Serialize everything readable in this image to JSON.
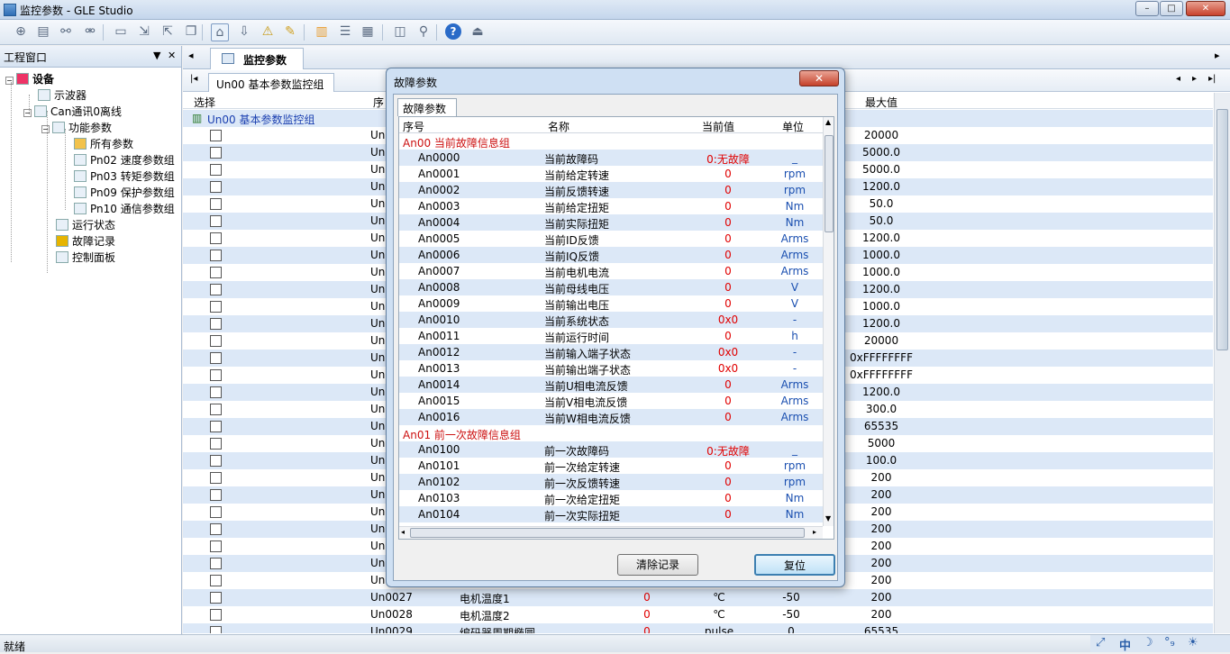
{
  "window": {
    "title": "监控参数 - GLE Studio",
    "min": "–",
    "max": "□",
    "close": "✕"
  },
  "toolbar": {
    "icons": [
      "new-icon",
      "open-icon",
      "connect-icon",
      "disconnect-icon",
      "window-icon",
      "import-icon",
      "export-icon",
      "copy-icon",
      "home-icon",
      "download-icon",
      "alarm-icon",
      "edit-icon",
      "chart-icon",
      "report-icon",
      "table-icon",
      "layout-icon",
      "zoom-icon",
      "help-icon",
      "exit-icon"
    ]
  },
  "left_panel": {
    "title": "工程窗口",
    "pin": "▼",
    "close": "✕",
    "tree": [
      {
        "label": "设备",
        "bold": true
      },
      {
        "label": "示波器"
      },
      {
        "label": "Can通讯0离线"
      },
      {
        "label": "功能参数"
      },
      {
        "label": "所有参数"
      },
      {
        "label": "Pn02 速度参数组"
      },
      {
        "label": "Pn03 转矩参数组"
      },
      {
        "label": "Pn09 保护参数组"
      },
      {
        "label": "Pn10 通信参数组"
      },
      {
        "label": "运行状态"
      },
      {
        "label": "故障记录"
      },
      {
        "label": "控制面板"
      }
    ]
  },
  "doc": {
    "tab": "监控参数",
    "subtab": "Un00 基本参数监控组",
    "col_select": "选择",
    "col_seq": "序",
    "col_max": "最大值",
    "group": "Un00 基本参数监控组",
    "rows_max": [
      "20000",
      "5000.0",
      "5000.0",
      "1200.0",
      "50.0",
      "50.0",
      "1200.0",
      "1000.0",
      "1000.0",
      "1200.0",
      "1000.0",
      "1200.0",
      "20000",
      "0xFFFFFFFF",
      "0xFFFFFFFF",
      "1200.0",
      "300.0",
      "65535",
      "5000",
      "100.0",
      "200",
      "200",
      "200",
      "200",
      "200",
      "200",
      "200"
    ],
    "row_code_prefix": "Un",
    "bottom_rows": [
      {
        "code": "Un0027",
        "name": "电机温度1",
        "val": "0",
        "unit": "℃",
        "min": "-50",
        "max": "200"
      },
      {
        "code": "Un0028",
        "name": "电机温度2",
        "val": "0",
        "unit": "℃",
        "min": "-50",
        "max": "200"
      },
      {
        "code": "Un0029",
        "name": "编码器周期椭圆",
        "val": "0",
        "unit": "pulse",
        "min": "0",
        "max": "65535"
      }
    ]
  },
  "status": {
    "text": "就绪",
    "tray": [
      "⤢",
      "中",
      "☽",
      "°₉",
      "☀"
    ]
  },
  "dialog": {
    "title": "故障参数",
    "close": "✕",
    "tab": "故障参数",
    "headers": {
      "seq": "序号",
      "name": "名称",
      "value": "当前值",
      "unit": "单位"
    },
    "rows": [
      {
        "group": "An00 当前故障信息组"
      },
      {
        "code": "An0000",
        "name": "当前故障码",
        "value": "0:无故障",
        "unit": "_"
      },
      {
        "code": "An0001",
        "name": "当前给定转速",
        "value": "0",
        "unit": "rpm"
      },
      {
        "code": "An0002",
        "name": "当前反馈转速",
        "value": "0",
        "unit": "rpm"
      },
      {
        "code": "An0003",
        "name": "当前给定扭矩",
        "value": "0",
        "unit": "Nm"
      },
      {
        "code": "An0004",
        "name": "当前实际扭矩",
        "value": "0",
        "unit": "Nm"
      },
      {
        "code": "An0005",
        "name": "当前ID反馈",
        "value": "0",
        "unit": "Arms"
      },
      {
        "code": "An0006",
        "name": "当前IQ反馈",
        "value": "0",
        "unit": "Arms"
      },
      {
        "code": "An0007",
        "name": "当前电机电流",
        "value": "0",
        "unit": "Arms"
      },
      {
        "code": "An0008",
        "name": "当前母线电压",
        "value": "0",
        "unit": "V"
      },
      {
        "code": "An0009",
        "name": "当前输出电压",
        "value": "0",
        "unit": "V"
      },
      {
        "code": "An0010",
        "name": "当前系统状态",
        "value": "0x0",
        "unit": "-"
      },
      {
        "code": "An0011",
        "name": "当前运行时间",
        "value": "0",
        "unit": "h"
      },
      {
        "code": "An0012",
        "name": "当前输入端子状态",
        "value": "0x0",
        "unit": "-"
      },
      {
        "code": "An0013",
        "name": "当前输出端子状态",
        "value": "0x0",
        "unit": "-"
      },
      {
        "code": "An0014",
        "name": "当前U相电流反馈",
        "value": "0",
        "unit": "Arms"
      },
      {
        "code": "An0015",
        "name": "当前V相电流反馈",
        "value": "0",
        "unit": "Arms"
      },
      {
        "code": "An0016",
        "name": "当前W相电流反馈",
        "value": "0",
        "unit": "Arms"
      },
      {
        "group": "An01 前一次故障信息组"
      },
      {
        "code": "An0100",
        "name": "前一次故障码",
        "value": "0:无故障",
        "unit": "_"
      },
      {
        "code": "An0101",
        "name": "前一次给定转速",
        "value": "0",
        "unit": "rpm"
      },
      {
        "code": "An0102",
        "name": "前一次反馈转速",
        "value": "0",
        "unit": "rpm"
      },
      {
        "code": "An0103",
        "name": "前一次给定扭矩",
        "value": "0",
        "unit": "Nm"
      },
      {
        "code": "An0104",
        "name": "前一次实际扭矩",
        "value": "0",
        "unit": "Nm"
      }
    ],
    "btn_clear": "清除记录",
    "btn_reset": "复位"
  }
}
